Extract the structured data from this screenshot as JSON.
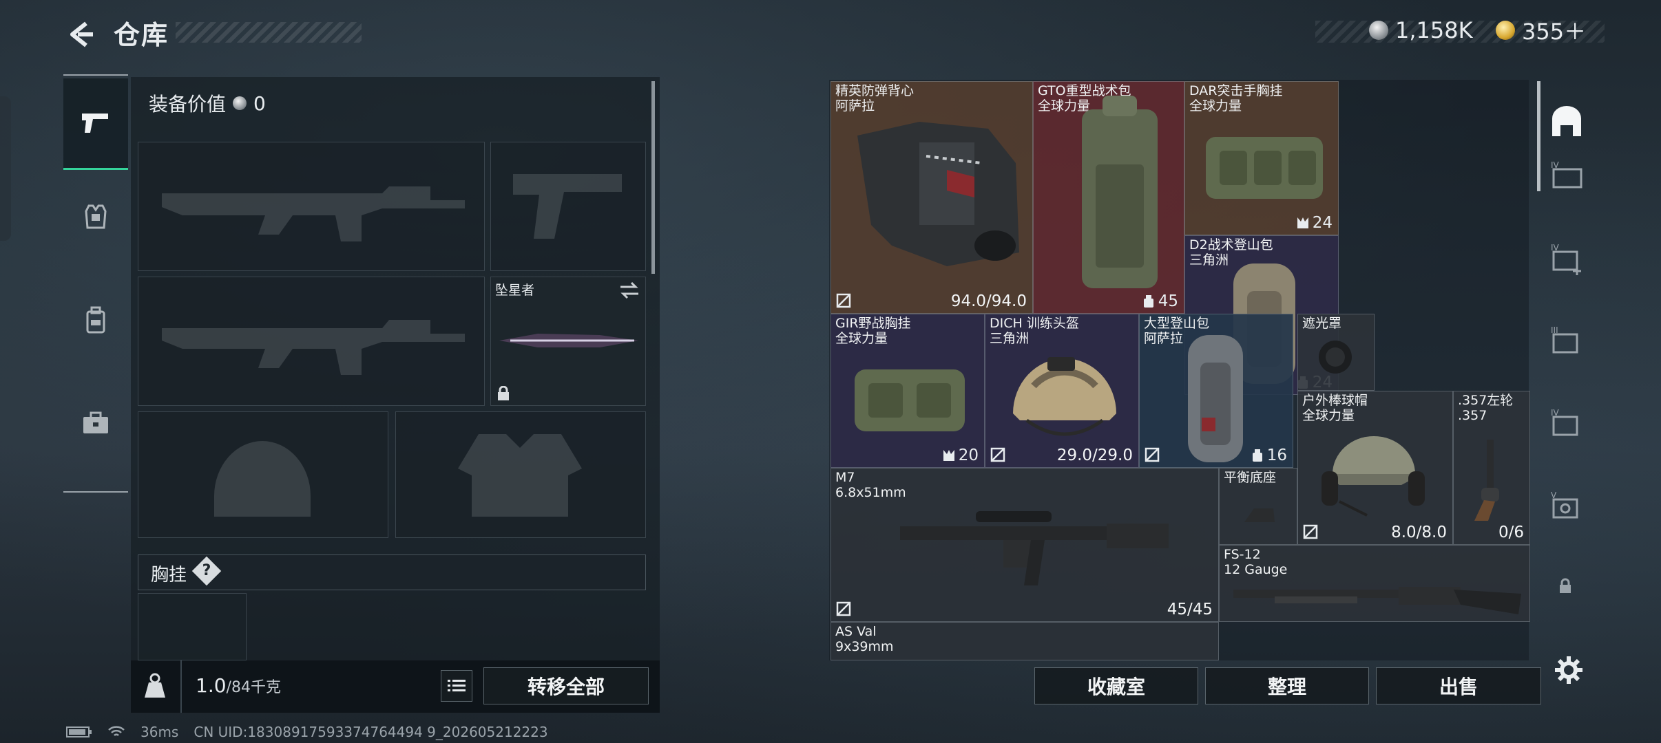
{
  "header": {
    "title": "仓库"
  },
  "currency": {
    "silver": "1,158K",
    "gold": "355＋"
  },
  "left_panel": {
    "equip_value_label": "装备价值",
    "equip_value": "0",
    "secondary_slot_name": "坠星者",
    "section_label": "胸挂",
    "section_help": "?",
    "weight_value": "1.0",
    "weight_max": "/84千克",
    "transfer_all": "转移全部"
  },
  "stash": {
    "items": [
      {
        "id": "vest",
        "name1": "精英防弹背心",
        "name2": "阿萨拉",
        "value": "94.0/94.0"
      },
      {
        "id": "gto",
        "name1": "GTO重型战术包",
        "name2": "全球力量",
        "value": "45"
      },
      {
        "id": "dar",
        "name1": "DAR突击手胸挂",
        "name2": "全球力量",
        "value": "24"
      },
      {
        "id": "d2",
        "name1": "D2战术登山包",
        "name2": "三角洲",
        "value": "24"
      },
      {
        "id": "gir",
        "name1": "GIR野战胸挂",
        "name2": "全球力量",
        "value": "20"
      },
      {
        "id": "dich",
        "name1": "DICH 训练头盔",
        "name2": "三角洲",
        "value": "29.0/29.0"
      },
      {
        "id": "bigpack",
        "name1": "大型登山包",
        "name2": "阿萨拉",
        "value": "16"
      },
      {
        "id": "shade",
        "name1": "遮光罩",
        "name2": "",
        "value": ""
      },
      {
        "id": "cap",
        "name1": "户外棒球帽",
        "name2": "全球力量",
        "value": "8.0/8.0"
      },
      {
        "id": "revolver",
        "name1": ".357左轮",
        "name2": ".357",
        "value": "0/6"
      },
      {
        "id": "m7",
        "name1": "M7",
        "name2": "6.8x51mm",
        "value": "45/45"
      },
      {
        "id": "base",
        "name1": "平衡底座",
        "name2": "",
        "value": ""
      },
      {
        "id": "fs12",
        "name1": "FS-12",
        "name2": "12 Gauge",
        "value": ""
      },
      {
        "id": "asval",
        "name1": "AS Val",
        "name2": "9x39mm",
        "value": ""
      }
    ]
  },
  "buttons": {
    "collection": "收藏室",
    "sort": "整理",
    "sell": "出售"
  },
  "status_bar": {
    "ping": "36ms",
    "uid": "CN UID:18308917593374764494 9_202605212223"
  },
  "colors": {
    "accent": "#35d49b",
    "brown": "#543e30",
    "red": "#622a30",
    "purple": "#2e2a46",
    "blue": "#24364a"
  }
}
